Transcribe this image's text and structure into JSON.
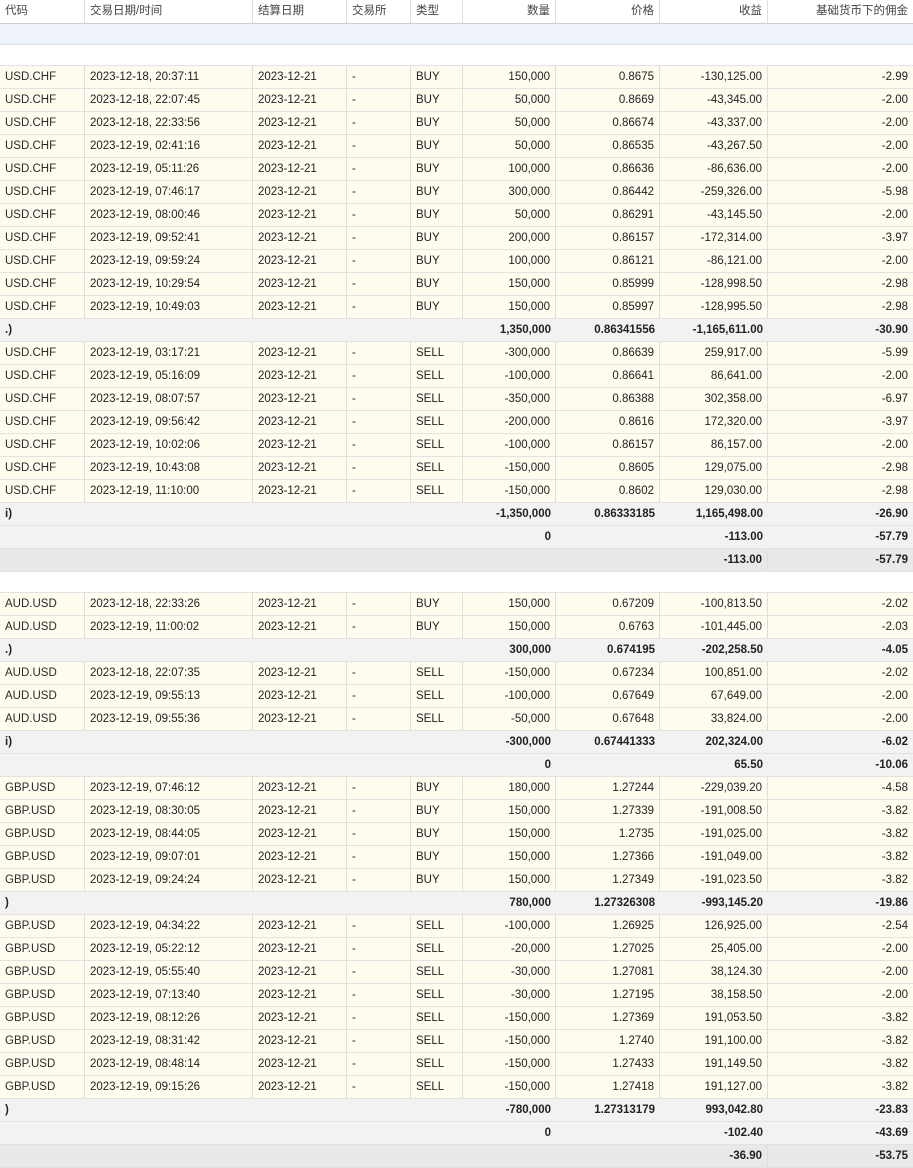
{
  "headers": [
    "代码",
    "交易日期/时间",
    "结算日期",
    "交易所",
    "类型",
    "数量",
    "价格",
    "收益",
    "基础货币下的佣金"
  ],
  "rows": [
    {
      "t": "spacer_blue"
    },
    {
      "t": "spacer"
    },
    {
      "t": "trade",
      "c": [
        "USD.CHF",
        "2023-12-18, 20:37:11",
        "2023-12-21",
        "-",
        "BUY",
        "150,000",
        "0.8675",
        "-130,125.00",
        "-2.99"
      ]
    },
    {
      "t": "trade",
      "c": [
        "USD.CHF",
        "2023-12-18, 22:07:45",
        "2023-12-21",
        "-",
        "BUY",
        "50,000",
        "0.8669",
        "-43,345.00",
        "-2.00"
      ]
    },
    {
      "t": "trade",
      "c": [
        "USD.CHF",
        "2023-12-18, 22:33:56",
        "2023-12-21",
        "-",
        "BUY",
        "50,000",
        "0.86674",
        "-43,337.00",
        "-2.00"
      ]
    },
    {
      "t": "trade",
      "c": [
        "USD.CHF",
        "2023-12-19, 02:41:16",
        "2023-12-21",
        "-",
        "BUY",
        "50,000",
        "0.86535",
        "-43,267.50",
        "-2.00"
      ]
    },
    {
      "t": "trade",
      "c": [
        "USD.CHF",
        "2023-12-19, 05:11:26",
        "2023-12-21",
        "-",
        "BUY",
        "100,000",
        "0.86636",
        "-86,636.00",
        "-2.00"
      ]
    },
    {
      "t": "trade",
      "c": [
        "USD.CHF",
        "2023-12-19, 07:46:17",
        "2023-12-21",
        "-",
        "BUY",
        "300,000",
        "0.86442",
        "-259,326.00",
        "-5.98"
      ]
    },
    {
      "t": "trade",
      "c": [
        "USD.CHF",
        "2023-12-19, 08:00:46",
        "2023-12-21",
        "-",
        "BUY",
        "50,000",
        "0.86291",
        "-43,145.50",
        "-2.00"
      ]
    },
    {
      "t": "trade",
      "c": [
        "USD.CHF",
        "2023-12-19, 09:52:41",
        "2023-12-21",
        "-",
        "BUY",
        "200,000",
        "0.86157",
        "-172,314.00",
        "-3.97"
      ]
    },
    {
      "t": "trade",
      "c": [
        "USD.CHF",
        "2023-12-19, 09:59:24",
        "2023-12-21",
        "-",
        "BUY",
        "100,000",
        "0.86121",
        "-86,121.00",
        "-2.00"
      ]
    },
    {
      "t": "trade",
      "c": [
        "USD.CHF",
        "2023-12-19, 10:29:54",
        "2023-12-21",
        "-",
        "BUY",
        "150,000",
        "0.85999",
        "-128,998.50",
        "-2.98"
      ]
    },
    {
      "t": "trade",
      "c": [
        "USD.CHF",
        "2023-12-19, 10:49:03",
        "2023-12-21",
        "-",
        "BUY",
        "150,000",
        "0.85997",
        "-128,995.50",
        "-2.98"
      ]
    },
    {
      "t": "sub",
      "label": ".)",
      "c": [
        "1,350,000",
        "0.86341556",
        "-1,165,611.00",
        "-30.90"
      ]
    },
    {
      "t": "trade",
      "c": [
        "USD.CHF",
        "2023-12-19, 03:17:21",
        "2023-12-21",
        "-",
        "SELL",
        "-300,000",
        "0.86639",
        "259,917.00",
        "-5.99"
      ]
    },
    {
      "t": "trade",
      "c": [
        "USD.CHF",
        "2023-12-19, 05:16:09",
        "2023-12-21",
        "-",
        "SELL",
        "-100,000",
        "0.86641",
        "86,641.00",
        "-2.00"
      ]
    },
    {
      "t": "trade",
      "c": [
        "USD.CHF",
        "2023-12-19, 08:07:57",
        "2023-12-21",
        "-",
        "SELL",
        "-350,000",
        "0.86388",
        "302,358.00",
        "-6.97"
      ]
    },
    {
      "t": "trade",
      "c": [
        "USD.CHF",
        "2023-12-19, 09:56:42",
        "2023-12-21",
        "-",
        "SELL",
        "-200,000",
        "0.8616",
        "172,320.00",
        "-3.97"
      ]
    },
    {
      "t": "trade",
      "c": [
        "USD.CHF",
        "2023-12-19, 10:02:06",
        "2023-12-21",
        "-",
        "SELL",
        "-100,000",
        "0.86157",
        "86,157.00",
        "-2.00"
      ]
    },
    {
      "t": "trade",
      "c": [
        "USD.CHF",
        "2023-12-19, 10:43:08",
        "2023-12-21",
        "-",
        "SELL",
        "-150,000",
        "0.8605",
        "129,075.00",
        "-2.98"
      ]
    },
    {
      "t": "trade",
      "c": [
        "USD.CHF",
        "2023-12-19, 11:10:00",
        "2023-12-21",
        "-",
        "SELL",
        "-150,000",
        "0.8602",
        "129,030.00",
        "-2.98"
      ]
    },
    {
      "t": "sub",
      "label": "i)",
      "c": [
        "-1,350,000",
        "0.86333185",
        "1,165,498.00",
        "-26.90"
      ]
    },
    {
      "t": "sub",
      "label": "",
      "c": [
        "0",
        "",
        "-113.00",
        "-57.79"
      ]
    },
    {
      "t": "sub",
      "label": "",
      "c": [
        "",
        "",
        "-113.00",
        "-57.79"
      ]
    },
    {
      "t": "spacer"
    },
    {
      "t": "trade",
      "c": [
        "AUD.USD",
        "2023-12-18, 22:33:26",
        "2023-12-21",
        "-",
        "BUY",
        "150,000",
        "0.67209",
        "-100,813.50",
        "-2.02"
      ]
    },
    {
      "t": "trade",
      "c": [
        "AUD.USD",
        "2023-12-19, 11:00:02",
        "2023-12-21",
        "-",
        "BUY",
        "150,000",
        "0.6763",
        "-101,445.00",
        "-2.03"
      ]
    },
    {
      "t": "sub",
      "label": ".)",
      "c": [
        "300,000",
        "0.674195",
        "-202,258.50",
        "-4.05"
      ]
    },
    {
      "t": "trade",
      "c": [
        "AUD.USD",
        "2023-12-18, 22:07:35",
        "2023-12-21",
        "-",
        "SELL",
        "-150,000",
        "0.67234",
        "100,851.00",
        "-2.02"
      ]
    },
    {
      "t": "trade",
      "c": [
        "AUD.USD",
        "2023-12-19, 09:55:13",
        "2023-12-21",
        "-",
        "SELL",
        "-100,000",
        "0.67649",
        "67,649.00",
        "-2.00"
      ]
    },
    {
      "t": "trade",
      "c": [
        "AUD.USD",
        "2023-12-19, 09:55:36",
        "2023-12-21",
        "-",
        "SELL",
        "-50,000",
        "0.67648",
        "33,824.00",
        "-2.00"
      ]
    },
    {
      "t": "sub",
      "label": "i)",
      "c": [
        "-300,000",
        "0.67441333",
        "202,324.00",
        "-6.02"
      ]
    },
    {
      "t": "sub",
      "label": "",
      "c": [
        "0",
        "",
        "65.50",
        "-10.06"
      ]
    },
    {
      "t": "trade",
      "c": [
        "GBP.USD",
        "2023-12-19, 07:46:12",
        "2023-12-21",
        "-",
        "BUY",
        "180,000",
        "1.27244",
        "-229,039.20",
        "-4.58"
      ]
    },
    {
      "t": "trade",
      "c": [
        "GBP.USD",
        "2023-12-19, 08:30:05",
        "2023-12-21",
        "-",
        "BUY",
        "150,000",
        "1.27339",
        "-191,008.50",
        "-3.82"
      ]
    },
    {
      "t": "trade",
      "c": [
        "GBP.USD",
        "2023-12-19, 08:44:05",
        "2023-12-21",
        "-",
        "BUY",
        "150,000",
        "1.2735",
        "-191,025.00",
        "-3.82"
      ]
    },
    {
      "t": "trade",
      "c": [
        "GBP.USD",
        "2023-12-19, 09:07:01",
        "2023-12-21",
        "-",
        "BUY",
        "150,000",
        "1.27366",
        "-191,049.00",
        "-3.82"
      ]
    },
    {
      "t": "trade",
      "c": [
        "GBP.USD",
        "2023-12-19, 09:24:24",
        "2023-12-21",
        "-",
        "BUY",
        "150,000",
        "1.27349",
        "-191,023.50",
        "-3.82"
      ]
    },
    {
      "t": "sub",
      "label": ")",
      "c": [
        "780,000",
        "1.27326308",
        "-993,145.20",
        "-19.86"
      ]
    },
    {
      "t": "trade",
      "c": [
        "GBP.USD",
        "2023-12-19, 04:34:22",
        "2023-12-21",
        "-",
        "SELL",
        "-100,000",
        "1.26925",
        "126,925.00",
        "-2.54"
      ]
    },
    {
      "t": "trade",
      "c": [
        "GBP.USD",
        "2023-12-19, 05:22:12",
        "2023-12-21",
        "-",
        "SELL",
        "-20,000",
        "1.27025",
        "25,405.00",
        "-2.00"
      ]
    },
    {
      "t": "trade",
      "c": [
        "GBP.USD",
        "2023-12-19, 05:55:40",
        "2023-12-21",
        "-",
        "SELL",
        "-30,000",
        "1.27081",
        "38,124.30",
        "-2.00"
      ]
    },
    {
      "t": "trade",
      "c": [
        "GBP.USD",
        "2023-12-19, 07:13:40",
        "2023-12-21",
        "-",
        "SELL",
        "-30,000",
        "1.27195",
        "38,158.50",
        "-2.00"
      ]
    },
    {
      "t": "trade",
      "c": [
        "GBP.USD",
        "2023-12-19, 08:12:26",
        "2023-12-21",
        "-",
        "SELL",
        "-150,000",
        "1.27369",
        "191,053.50",
        "-3.82"
      ]
    },
    {
      "t": "trade",
      "c": [
        "GBP.USD",
        "2023-12-19, 08:31:42",
        "2023-12-21",
        "-",
        "SELL",
        "-150,000",
        "1.2740",
        "191,100.00",
        "-3.82"
      ]
    },
    {
      "t": "trade",
      "c": [
        "GBP.USD",
        "2023-12-19, 08:48:14",
        "2023-12-21",
        "-",
        "SELL",
        "-150,000",
        "1.27433",
        "191,149.50",
        "-3.82"
      ]
    },
    {
      "t": "trade",
      "c": [
        "GBP.USD",
        "2023-12-19, 09:15:26",
        "2023-12-21",
        "-",
        "SELL",
        "-150,000",
        "1.27418",
        "191,127.00",
        "-3.82"
      ]
    },
    {
      "t": "sub",
      "label": ")",
      "c": [
        "-780,000",
        "1.27313179",
        "993,042.80",
        "-23.83"
      ]
    },
    {
      "t": "sub",
      "label": "",
      "c": [
        "0",
        "",
        "-102.40",
        "-43.69"
      ]
    },
    {
      "t": "sub",
      "label": "",
      "c": [
        "",
        "",
        "-36.90",
        "-53.75"
      ]
    }
  ]
}
